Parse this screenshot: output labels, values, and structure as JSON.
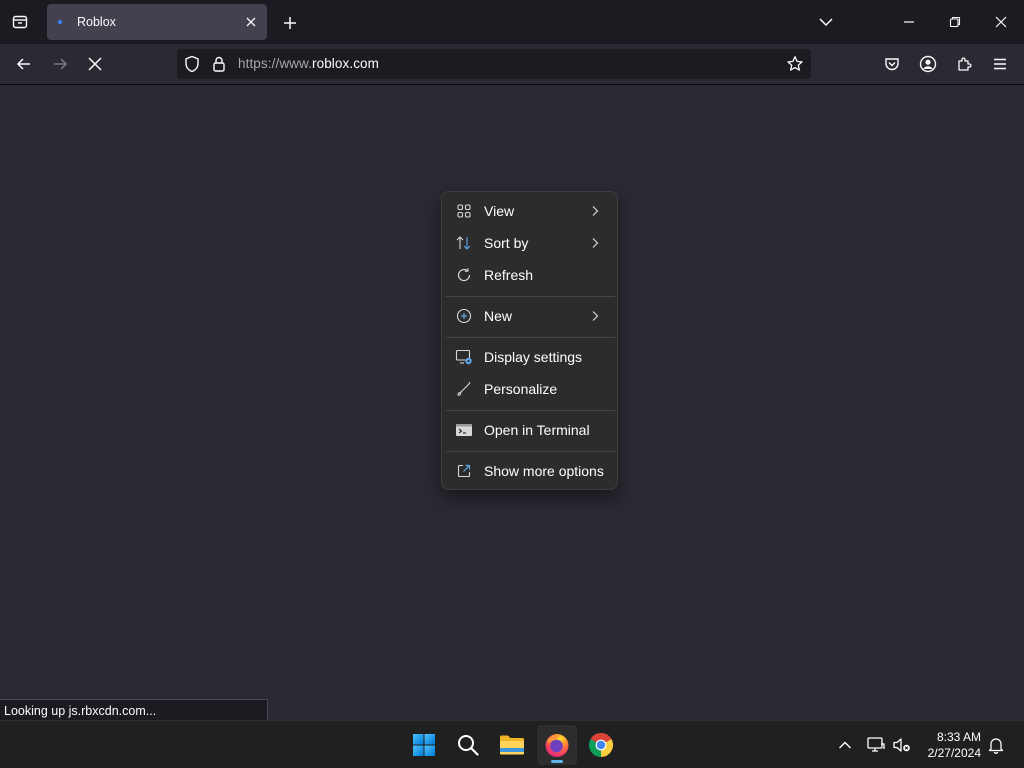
{
  "browser": {
    "tab": {
      "title": "Roblox"
    },
    "url": {
      "prefix": "https://www.",
      "domain": "roblox.com"
    },
    "status_text": "Looking up js.rbxcdn.com..."
  },
  "context_menu": {
    "items": [
      {
        "label": "View",
        "icon": "grid-icon",
        "submenu": true
      },
      {
        "label": "Sort by",
        "icon": "sort-icon",
        "submenu": true
      },
      {
        "label": "Refresh",
        "icon": "refresh-icon",
        "submenu": false
      },
      {
        "label": "New",
        "icon": "plus-circle-icon",
        "submenu": true
      },
      {
        "label": "Display settings",
        "icon": "display-icon",
        "submenu": false
      },
      {
        "label": "Personalize",
        "icon": "brush-icon",
        "submenu": false
      },
      {
        "label": "Open in Terminal",
        "icon": "terminal-icon",
        "submenu": false
      },
      {
        "label": "Show more options",
        "icon": "external-icon",
        "submenu": false
      }
    ]
  },
  "taskbar": {
    "apps": [
      "start-icon",
      "search-icon",
      "file-explorer-icon",
      "firefox-icon",
      "chrome-icon"
    ],
    "clock": {
      "time": "8:33 AM",
      "date": "2/27/2024"
    }
  },
  "colors": {
    "page_bg": "#2b2a33",
    "toolbar_bg": "#1c1b22",
    "menu_bg": "#2c2c2c",
    "accent": "#62b3ec"
  }
}
